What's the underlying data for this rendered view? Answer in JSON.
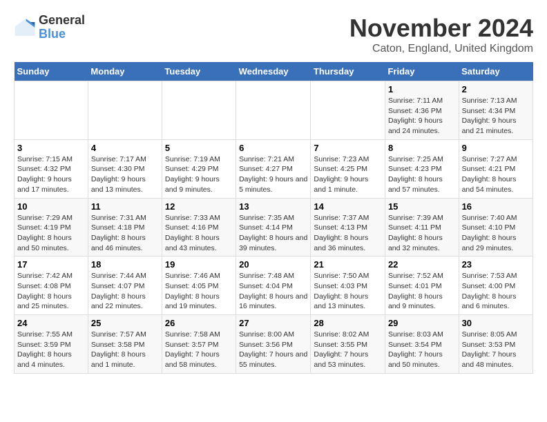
{
  "logo": {
    "general": "General",
    "blue": "Blue"
  },
  "title": "November 2024",
  "location": "Caton, England, United Kingdom",
  "weekdays": [
    "Sunday",
    "Monday",
    "Tuesday",
    "Wednesday",
    "Thursday",
    "Friday",
    "Saturday"
  ],
  "weeks": [
    [
      {
        "day": "",
        "info": ""
      },
      {
        "day": "",
        "info": ""
      },
      {
        "day": "",
        "info": ""
      },
      {
        "day": "",
        "info": ""
      },
      {
        "day": "",
        "info": ""
      },
      {
        "day": "1",
        "info": "Sunrise: 7:11 AM\nSunset: 4:36 PM\nDaylight: 9 hours and 24 minutes."
      },
      {
        "day": "2",
        "info": "Sunrise: 7:13 AM\nSunset: 4:34 PM\nDaylight: 9 hours and 21 minutes."
      }
    ],
    [
      {
        "day": "3",
        "info": "Sunrise: 7:15 AM\nSunset: 4:32 PM\nDaylight: 9 hours and 17 minutes."
      },
      {
        "day": "4",
        "info": "Sunrise: 7:17 AM\nSunset: 4:30 PM\nDaylight: 9 hours and 13 minutes."
      },
      {
        "day": "5",
        "info": "Sunrise: 7:19 AM\nSunset: 4:29 PM\nDaylight: 9 hours and 9 minutes."
      },
      {
        "day": "6",
        "info": "Sunrise: 7:21 AM\nSunset: 4:27 PM\nDaylight: 9 hours and 5 minutes."
      },
      {
        "day": "7",
        "info": "Sunrise: 7:23 AM\nSunset: 4:25 PM\nDaylight: 9 hours and 1 minute."
      },
      {
        "day": "8",
        "info": "Sunrise: 7:25 AM\nSunset: 4:23 PM\nDaylight: 8 hours and 57 minutes."
      },
      {
        "day": "9",
        "info": "Sunrise: 7:27 AM\nSunset: 4:21 PM\nDaylight: 8 hours and 54 minutes."
      }
    ],
    [
      {
        "day": "10",
        "info": "Sunrise: 7:29 AM\nSunset: 4:19 PM\nDaylight: 8 hours and 50 minutes."
      },
      {
        "day": "11",
        "info": "Sunrise: 7:31 AM\nSunset: 4:18 PM\nDaylight: 8 hours and 46 minutes."
      },
      {
        "day": "12",
        "info": "Sunrise: 7:33 AM\nSunset: 4:16 PM\nDaylight: 8 hours and 43 minutes."
      },
      {
        "day": "13",
        "info": "Sunrise: 7:35 AM\nSunset: 4:14 PM\nDaylight: 8 hours and 39 minutes."
      },
      {
        "day": "14",
        "info": "Sunrise: 7:37 AM\nSunset: 4:13 PM\nDaylight: 8 hours and 36 minutes."
      },
      {
        "day": "15",
        "info": "Sunrise: 7:39 AM\nSunset: 4:11 PM\nDaylight: 8 hours and 32 minutes."
      },
      {
        "day": "16",
        "info": "Sunrise: 7:40 AM\nSunset: 4:10 PM\nDaylight: 8 hours and 29 minutes."
      }
    ],
    [
      {
        "day": "17",
        "info": "Sunrise: 7:42 AM\nSunset: 4:08 PM\nDaylight: 8 hours and 25 minutes."
      },
      {
        "day": "18",
        "info": "Sunrise: 7:44 AM\nSunset: 4:07 PM\nDaylight: 8 hours and 22 minutes."
      },
      {
        "day": "19",
        "info": "Sunrise: 7:46 AM\nSunset: 4:05 PM\nDaylight: 8 hours and 19 minutes."
      },
      {
        "day": "20",
        "info": "Sunrise: 7:48 AM\nSunset: 4:04 PM\nDaylight: 8 hours and 16 minutes."
      },
      {
        "day": "21",
        "info": "Sunrise: 7:50 AM\nSunset: 4:03 PM\nDaylight: 8 hours and 13 minutes."
      },
      {
        "day": "22",
        "info": "Sunrise: 7:52 AM\nSunset: 4:01 PM\nDaylight: 8 hours and 9 minutes."
      },
      {
        "day": "23",
        "info": "Sunrise: 7:53 AM\nSunset: 4:00 PM\nDaylight: 8 hours and 6 minutes."
      }
    ],
    [
      {
        "day": "24",
        "info": "Sunrise: 7:55 AM\nSunset: 3:59 PM\nDaylight: 8 hours and 4 minutes."
      },
      {
        "day": "25",
        "info": "Sunrise: 7:57 AM\nSunset: 3:58 PM\nDaylight: 8 hours and 1 minute."
      },
      {
        "day": "26",
        "info": "Sunrise: 7:58 AM\nSunset: 3:57 PM\nDaylight: 7 hours and 58 minutes."
      },
      {
        "day": "27",
        "info": "Sunrise: 8:00 AM\nSunset: 3:56 PM\nDaylight: 7 hours and 55 minutes."
      },
      {
        "day": "28",
        "info": "Sunrise: 8:02 AM\nSunset: 3:55 PM\nDaylight: 7 hours and 53 minutes."
      },
      {
        "day": "29",
        "info": "Sunrise: 8:03 AM\nSunset: 3:54 PM\nDaylight: 7 hours and 50 minutes."
      },
      {
        "day": "30",
        "info": "Sunrise: 8:05 AM\nSunset: 3:53 PM\nDaylight: 7 hours and 48 minutes."
      }
    ]
  ]
}
